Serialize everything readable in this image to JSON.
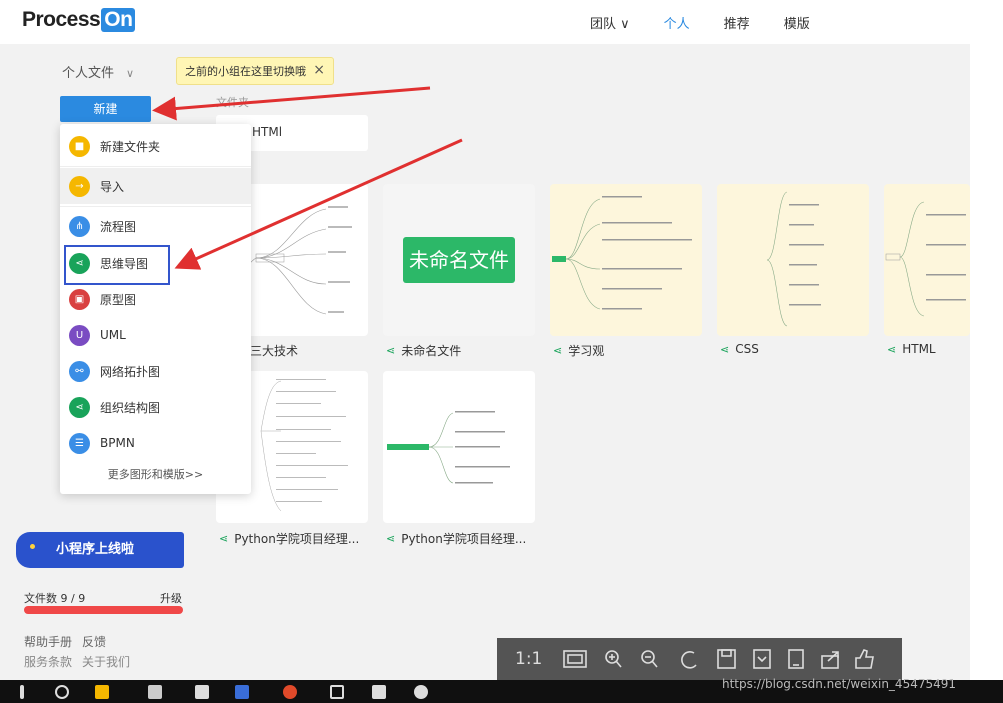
{
  "header": {
    "logo_text": "Process",
    "logo_on": "On",
    "nav": [
      {
        "label": "团队 ∨"
      },
      {
        "label": "个人"
      },
      {
        "label": "推荐"
      },
      {
        "label": "模版"
      }
    ]
  },
  "context": {
    "label": "个人文件",
    "chevron": "∨"
  },
  "tip": {
    "text": "之前的小组在这里切换哦",
    "close": "×"
  },
  "new_button": "新建",
  "folder_section_label": "文件夹",
  "folders": [
    {
      "name": "HTMl"
    }
  ],
  "menu": {
    "items": [
      {
        "label": "新建文件夹",
        "icon": "folder-icon",
        "color": "#f5b700",
        "glyph": "■"
      },
      {
        "label": "导入",
        "icon": "import-icon",
        "color": "#f5b700",
        "glyph": "→"
      },
      {
        "label": "流程图",
        "icon": "flowchart-icon",
        "color": "#3a8ee6",
        "glyph": "⋔"
      },
      {
        "label": "思维导图",
        "icon": "mindmap-icon",
        "color": "#19a35a",
        "glyph": "⋖"
      },
      {
        "label": "原型图",
        "icon": "prototype-icon",
        "color": "#d94040",
        "glyph": "▣"
      },
      {
        "label": "UML",
        "icon": "uml-icon",
        "color": "#7a4cc2",
        "glyph": "U"
      },
      {
        "label": "网络拓扑图",
        "icon": "network-icon",
        "color": "#3a8ee6",
        "glyph": "⚯"
      },
      {
        "label": "组织结构图",
        "icon": "orgchart-icon",
        "color": "#19a35a",
        "glyph": "⋖"
      },
      {
        "label": "BPMN",
        "icon": "bpmn-icon",
        "color": "#3a8ee6",
        "glyph": "☰"
      }
    ],
    "more": "更多图形和模版>>"
  },
  "files": [
    {
      "name": "端三大技术",
      "variant": "white"
    },
    {
      "name": "未命名文件",
      "variant": "gray",
      "thumb_text": "未命名文件"
    },
    {
      "name": "学习观",
      "variant": "yellow"
    },
    {
      "name": "CSS",
      "variant": "yellow"
    },
    {
      "name": "HTML",
      "variant": "yellow"
    },
    {
      "name": "Python学院项目经理...",
      "variant": "white"
    },
    {
      "name": "Python学院项目经理...",
      "variant": "white"
    }
  ],
  "mindmap_glyph": "⋖",
  "sidebar": {
    "promo": "小程序上线啦",
    "file_count": "文件数 9 / 9",
    "upgrade": "升级",
    "file_usage": 1.0,
    "links_row1": [
      "帮助手册",
      "反馈"
    ],
    "links_row2": [
      "服务条款",
      "关于我们"
    ]
  },
  "viewer": {
    "ratio": "1:1",
    "tools": [
      "fit-icon",
      "zoom-in-icon",
      "zoom-out-icon",
      "rotate-icon",
      "save-icon",
      "bookmark-icon",
      "tablet-icon",
      "share-icon",
      "like-icon"
    ]
  },
  "watermark": "https://blog.csdn.net/weixin_45475491",
  "colors": {
    "accent": "#2b8ae0",
    "arrow": "#e03030",
    "highlight": "#3355cc",
    "mindmap_green": "#19a35a"
  }
}
